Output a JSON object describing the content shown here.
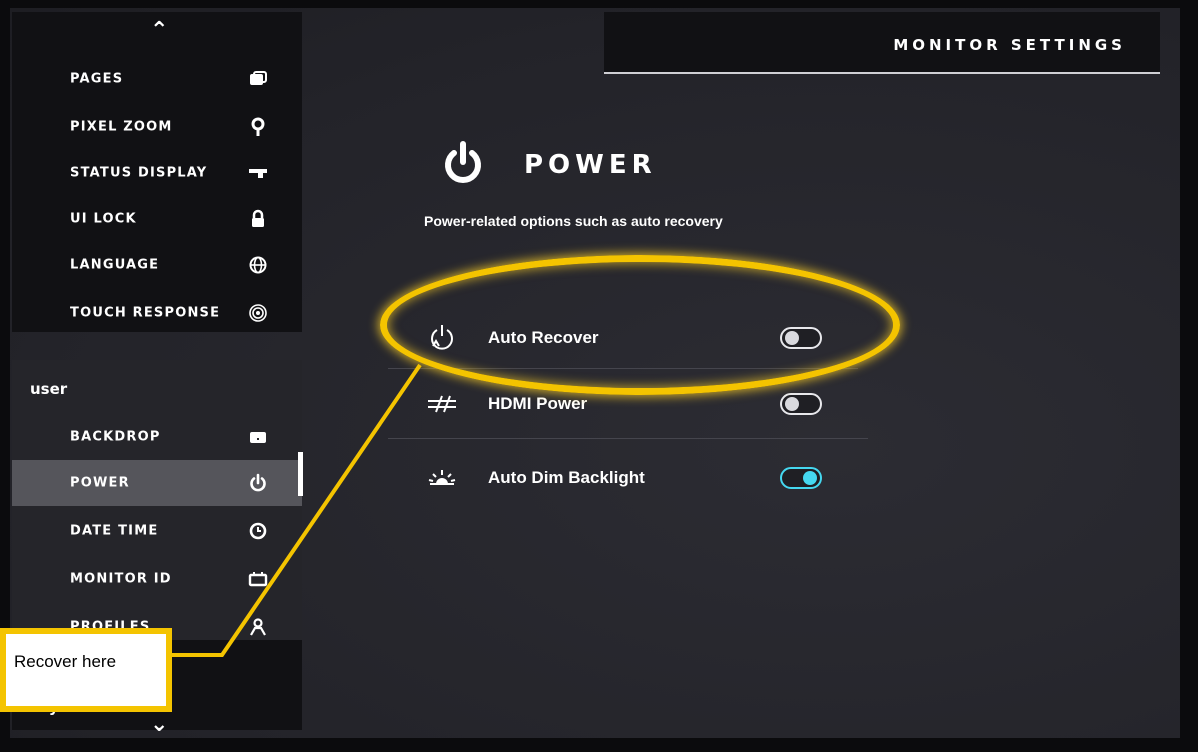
{
  "header": {
    "title": "MONITOR SETTINGS"
  },
  "sidebar": {
    "top_items": [
      {
        "label": "PAGES",
        "icon": "pages-icon"
      },
      {
        "label": "PIXEL ZOOM",
        "icon": "location-pin-icon"
      },
      {
        "label": "STATUS DISPLAY",
        "icon": "status-bar-icon"
      },
      {
        "label": "UI LOCK",
        "icon": "lock-icon"
      },
      {
        "label": "LANGUAGE",
        "icon": "globe-icon"
      },
      {
        "label": "TOUCH RESPONSE",
        "icon": "touch-ripple-icon"
      }
    ],
    "section_user": "user",
    "user_items": [
      {
        "label": "BACKDROP",
        "icon": "backdrop-icon"
      },
      {
        "label": "POWER",
        "icon": "power-icon",
        "active": true
      },
      {
        "label": "DATE TIME",
        "icon": "clock-icon"
      },
      {
        "label": "MONITOR ID",
        "icon": "monitor-id-icon"
      },
      {
        "label": "PROFILES",
        "icon": "profiles-icon"
      }
    ],
    "section_system": "system"
  },
  "main": {
    "title": "POWER",
    "description": "Power-related options such as auto recovery",
    "settings": [
      {
        "label": "Auto Recover",
        "icon": "auto-recover-icon",
        "enabled": false
      },
      {
        "label": "HDMI Power",
        "icon": "hdmi-power-icon",
        "enabled": false
      },
      {
        "label": "Auto Dim Backlight",
        "icon": "backlight-icon",
        "enabled": true
      }
    ]
  },
  "annotation": {
    "callout_text": "Recover here"
  },
  "colors": {
    "accent": "#45d8f0",
    "highlight": "#f4c400",
    "active_item": "#55555b"
  }
}
